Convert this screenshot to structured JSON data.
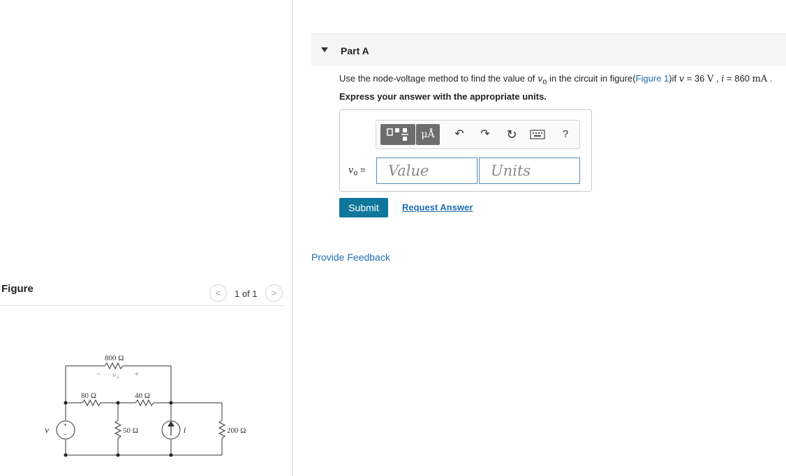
{
  "figure": {
    "title": "Figure",
    "pager": {
      "prev_icon": "chevron-left-icon",
      "text": "1 of 1",
      "next_icon": "chevron-right-icon"
    },
    "circuit": {
      "r_top": "800 Ω",
      "vo_label": "v",
      "vo_sub": "o",
      "minus": "−",
      "plus": "+",
      "r_left": "80 Ω",
      "r_mid": "40 Ω",
      "r_center": "50 Ω",
      "r_right": "200 Ω",
      "source_v": "v",
      "source_i": "i"
    }
  },
  "part_a": {
    "title": "Part A",
    "question": {
      "prefix": "Use the node-voltage method to find the value of ",
      "var": "v",
      "var_sub": "o",
      "middle": " in the circuit in figure(",
      "figure_link": "Figure 1",
      "suffix": ")if ",
      "v_sym": "v",
      "v_eq": " = 36 ",
      "v_unit": "V",
      "sep": " , ",
      "i_sym": "i",
      "i_eq": " = 860 ",
      "i_unit": "mA",
      "end": " ."
    },
    "instruction": "Express your answer with the appropriate units.",
    "toolbar": {
      "units_label": "μÅ",
      "undo_icon": "↶",
      "redo_icon": "↷",
      "reset_icon": "↻",
      "help_label": "?"
    },
    "answer": {
      "var": "v",
      "var_sub": "o",
      "equals": " =",
      "value_placeholder": "Value",
      "units_placeholder": "Units"
    },
    "submit_label": "Submit",
    "request_label": "Request Answer"
  },
  "feedback_label": "Provide Feedback"
}
